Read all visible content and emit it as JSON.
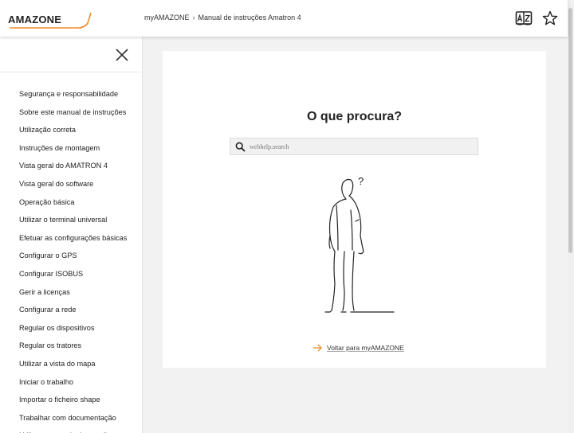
{
  "header": {
    "logo_text": "AMAZONE",
    "breadcrumb": [
      "myAMAZONE",
      "Manual de instruções Amatron 4"
    ],
    "breadcrumb_separator": "›",
    "icons": [
      "glossary-az-icon",
      "star-icon"
    ]
  },
  "sidebar": {
    "close_icon": "close-icon",
    "items": [
      {
        "label": "Segurança e responsabilidade"
      },
      {
        "label": "Sobre este manual de instruções"
      },
      {
        "label": "Utilização correta"
      },
      {
        "label": "Instruções de montagem"
      },
      {
        "label": "Vista geral do AMATRON 4"
      },
      {
        "label": "Vista geral do software"
      },
      {
        "label": "Operação básica"
      },
      {
        "label": "Utilizar o terminal universal"
      },
      {
        "label": "Efetuar as configurações básicas"
      },
      {
        "label": "Configurar o GPS"
      },
      {
        "label": "Configurar ISOBUS"
      },
      {
        "label": "Gerir a licenças"
      },
      {
        "label": "Configurar a rede"
      },
      {
        "label": "Regular os dispositivos"
      },
      {
        "label": "Regular os tratores"
      },
      {
        "label": "Utilizar a vista do mapa"
      },
      {
        "label": "Iniciar o trabalho"
      },
      {
        "label": "Importar o ficheiro shape"
      },
      {
        "label": "Trabalhar com documentação"
      },
      {
        "label": "Utilizar o controlo de secções"
      }
    ]
  },
  "main": {
    "title": "O que procura?",
    "search": {
      "placeholder": "webhelp.search",
      "value": ""
    },
    "illustration_mark": "?",
    "back_link": "Voltar para myAMAZONE"
  },
  "colors": {
    "accent_orange": "#f28c28",
    "page_bg": "#f2f2f2",
    "card_bg": "#ffffff"
  }
}
